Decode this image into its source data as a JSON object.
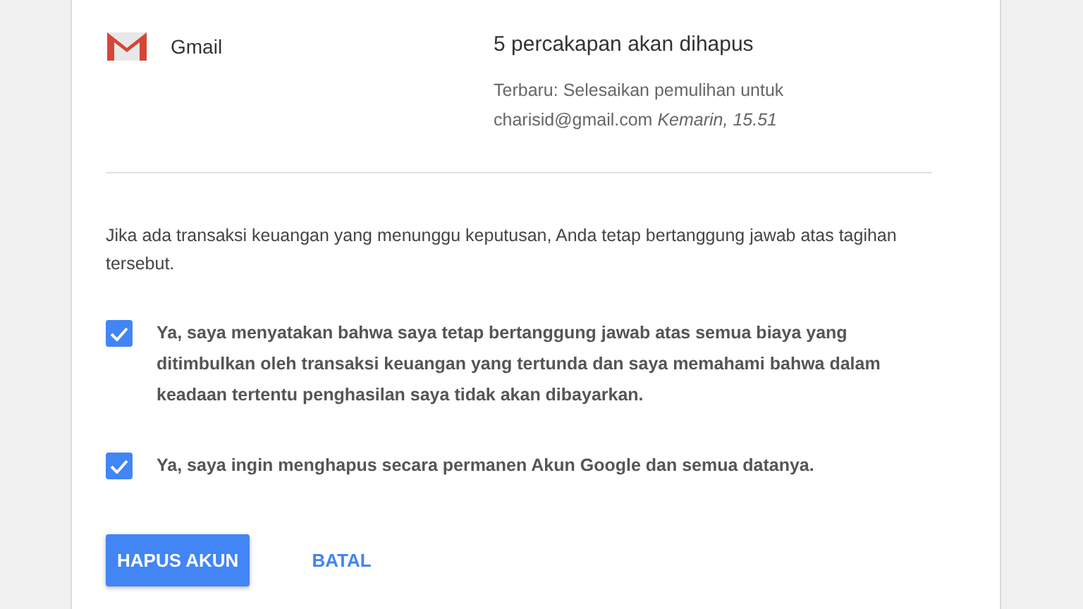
{
  "service": {
    "name": "Gmail",
    "summary": "5 percakapan akan dihapus",
    "detail": "Terbaru: Selesaikan pemulihan untuk charisid@gmail.com *Kemarin, 15.51*"
  },
  "notice": "Jika ada transaksi keuangan yang menunggu keputusan, Anda tetap bertanggung jawab atas tagihan tersebut.",
  "confirmations": [
    {
      "label": "Ya, saya menyatakan bahwa saya tetap bertanggung jawab atas semua biaya yang ditimbulkan oleh transaksi keuangan yang tertunda dan saya memahami bahwa dalam keadaan tertentu penghasilan saya tidak akan dibayarkan.",
      "checked": true
    },
    {
      "label": "Ya, saya ingin menghapus secara permanen Akun Google dan semua datanya.",
      "checked": true
    }
  ],
  "buttons": {
    "primary": "HAPUS AKUN",
    "secondary": "BATAL"
  }
}
